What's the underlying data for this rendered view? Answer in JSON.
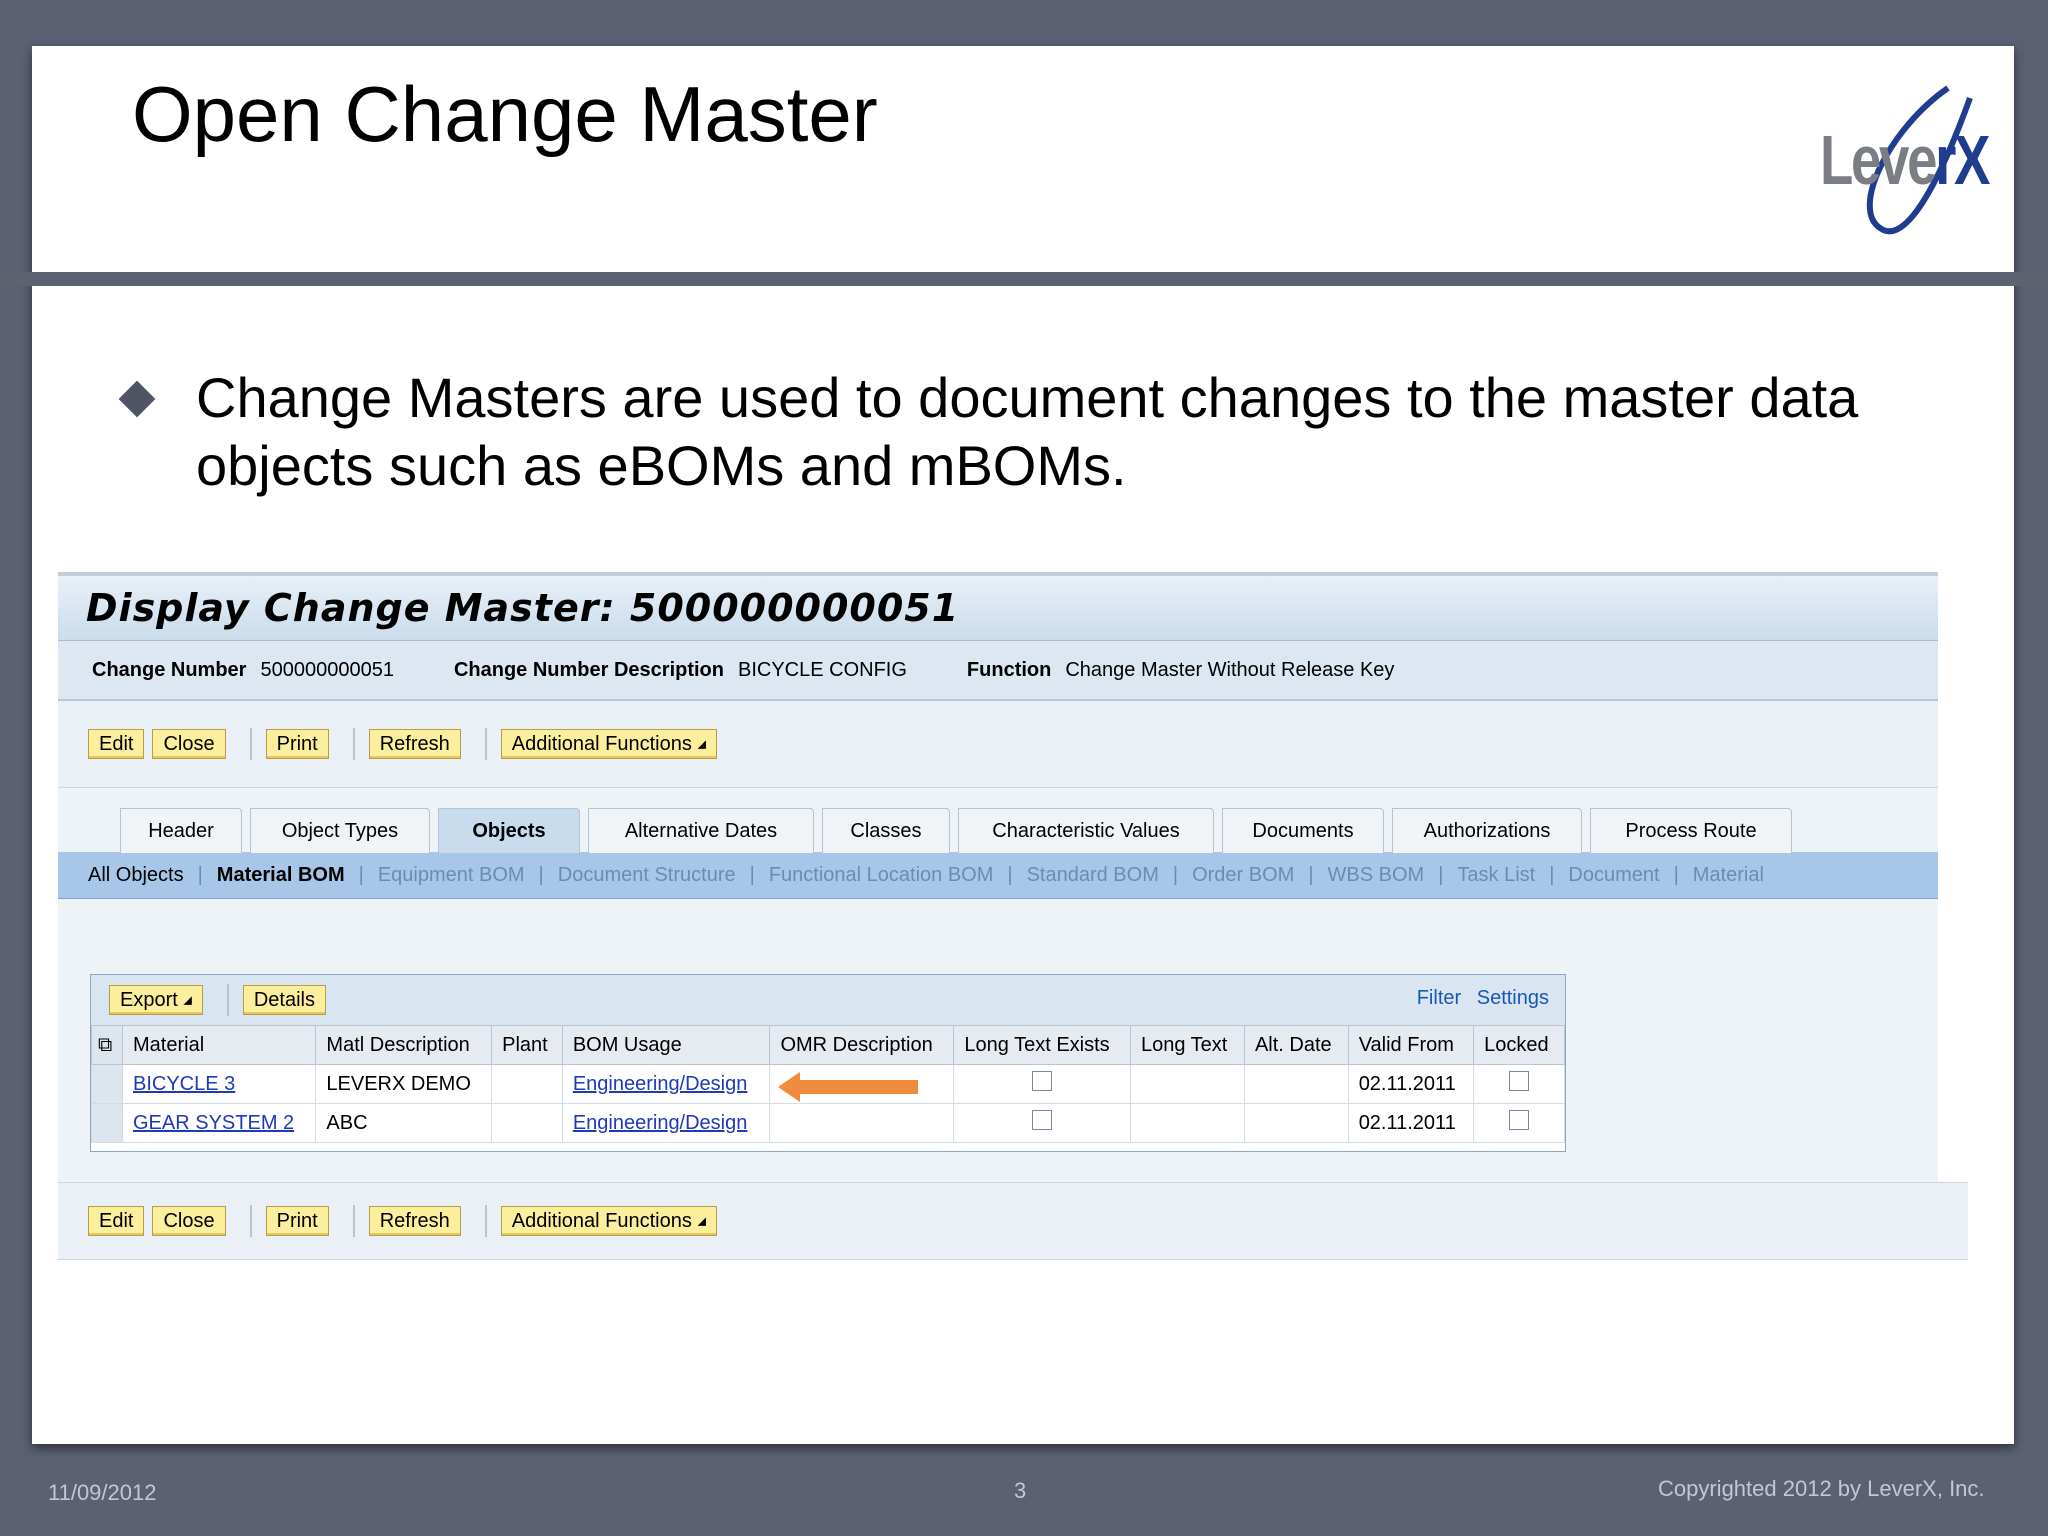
{
  "slide": {
    "title": "Open Change Master",
    "logo_text_main": "Leve",
    "logo_text_accent": "rX",
    "bullet": "Change Masters are used to document changes to the master data objects  such as eBOMs and mBOMs."
  },
  "sap": {
    "title": "Display Change Master: 500000000051",
    "info": {
      "change_number_label": "Change Number",
      "change_number": "500000000051",
      "description_label": "Change Number Description",
      "description": "BICYCLE CONFIG",
      "function_label": "Function",
      "function": "Change Master Without Release Key"
    },
    "toolbar": {
      "edit": "Edit",
      "close": "Close",
      "print": "Print",
      "refresh": "Refresh",
      "additional": "Additional Functions"
    },
    "tabs": [
      "Header",
      "Object Types",
      "Objects",
      "Alternative Dates",
      "Classes",
      "Characteristic Values",
      "Documents",
      "Authorizations",
      "Process Route"
    ],
    "active_tab": "Objects",
    "subnav": [
      "All Objects",
      "Material BOM",
      "Equipment BOM",
      "Document Structure",
      "Functional Location BOM",
      "Standard BOM",
      "Order BOM",
      "WBS BOM",
      "Task List",
      "Document",
      "Material"
    ],
    "table_toolbar": {
      "export": "Export",
      "details": "Details",
      "filter": "Filter",
      "settings": "Settings"
    },
    "columns": [
      "Material",
      "Matl Description",
      "Plant",
      "BOM Usage",
      "OMR Description",
      "Long Text Exists",
      "Long Text",
      "Alt. Date",
      "Valid From",
      "Locked"
    ],
    "rows": [
      {
        "material": "BICYCLE 3",
        "description": "LEVERX DEMO",
        "plant": "",
        "usage": "Engineering/Design",
        "omr": "",
        "long_text": "",
        "alt_date": "",
        "valid_from": "02.11.2011"
      },
      {
        "material": "GEAR SYSTEM 2",
        "description": "ABC",
        "plant": "",
        "usage": "Engineering/Design",
        "omr": "",
        "long_text": "",
        "alt_date": "",
        "valid_from": "02.11.2011"
      }
    ]
  },
  "colors": {
    "arrow": "#f08a3c",
    "link": "#1d3ab8",
    "button": "#fbee9d"
  },
  "footer": {
    "date": "11/09/2012",
    "page": "3",
    "copyright": "Copyrighted 2012 by LeverX, Inc."
  }
}
